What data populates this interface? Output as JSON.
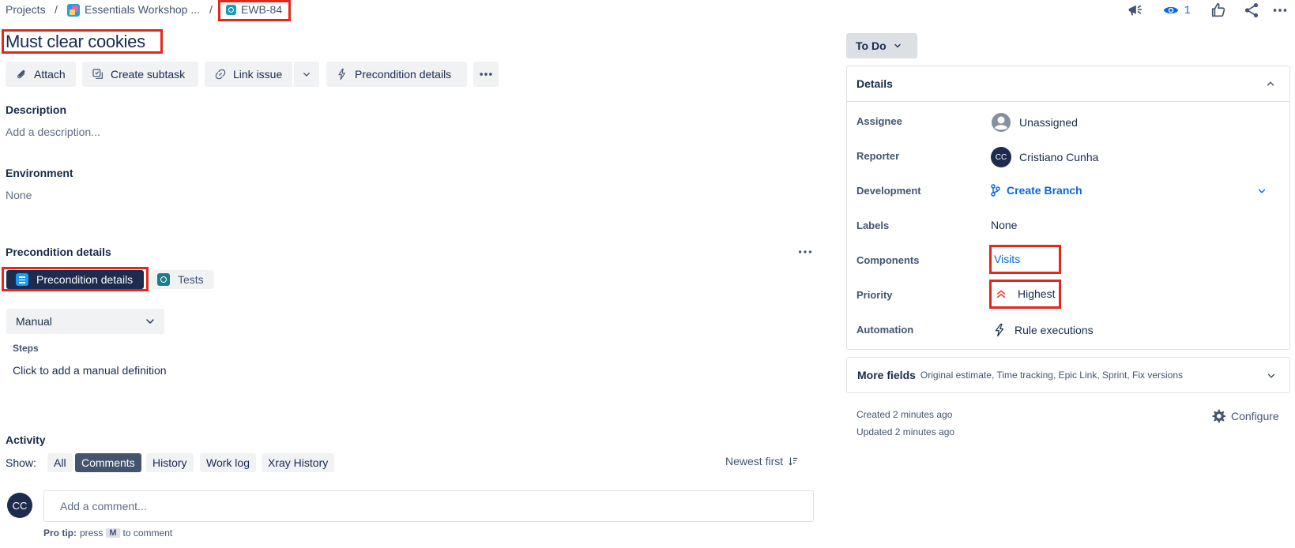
{
  "breadcrumb": {
    "projects": "Projects",
    "separator": "/",
    "project_name": "Essentials Workshop ...",
    "issue_key": "EWB-84"
  },
  "header_actions": {
    "watch_count": "1"
  },
  "issue": {
    "title": "Must clear cookies"
  },
  "toolbar": {
    "attach": "Attach",
    "create_subtask": "Create subtask",
    "link_issue": "Link issue",
    "precondition_details": "Precondition details"
  },
  "description": {
    "heading": "Description",
    "placeholder": "Add a description..."
  },
  "environment": {
    "heading": "Environment",
    "value": "None"
  },
  "precondition": {
    "heading": "Precondition details",
    "tab_active": "Precondition details",
    "tab_tests": "Tests",
    "type_select": "Manual",
    "steps_label": "Steps",
    "steps_placeholder": "Click to add a manual definition"
  },
  "activity": {
    "heading": "Activity",
    "show_label": "Show:",
    "filters": [
      "All",
      "Comments",
      "History",
      "Work log",
      "Xray History"
    ],
    "active_filter": "Comments",
    "sort": "Newest first",
    "avatar_initials": "CC",
    "comment_placeholder": "Add a comment...",
    "pro_tip_bold": "Pro tip:",
    "pro_tip_press": "press",
    "pro_tip_key": "M",
    "pro_tip_rest": "to comment"
  },
  "status": {
    "label": "To Do"
  },
  "details": {
    "heading": "Details",
    "assignee_label": "Assignee",
    "assignee_value": "Unassigned",
    "reporter_label": "Reporter",
    "reporter_initials": "CC",
    "reporter_value": "Cristiano Cunha",
    "development_label": "Development",
    "development_value": "Create Branch",
    "labels_label": "Labels",
    "labels_value": "None",
    "components_label": "Components",
    "components_value": "Visits",
    "priority_label": "Priority",
    "priority_value": "Highest",
    "automation_label": "Automation",
    "automation_value": "Rule executions"
  },
  "more_fields": {
    "heading": "More fields",
    "summary": "Original estimate, Time tracking, Epic Link, Sprint, Fix versions"
  },
  "meta": {
    "created": "Created 2 minutes ago",
    "updated": "Updated 2 minutes ago",
    "configure": "Configure"
  },
  "colors": {
    "highlight": "#e4271b",
    "link": "#0c66e4",
    "priority": "#e5493a",
    "active_pill": "#44546f",
    "active_tab": "#1d2b4e"
  }
}
